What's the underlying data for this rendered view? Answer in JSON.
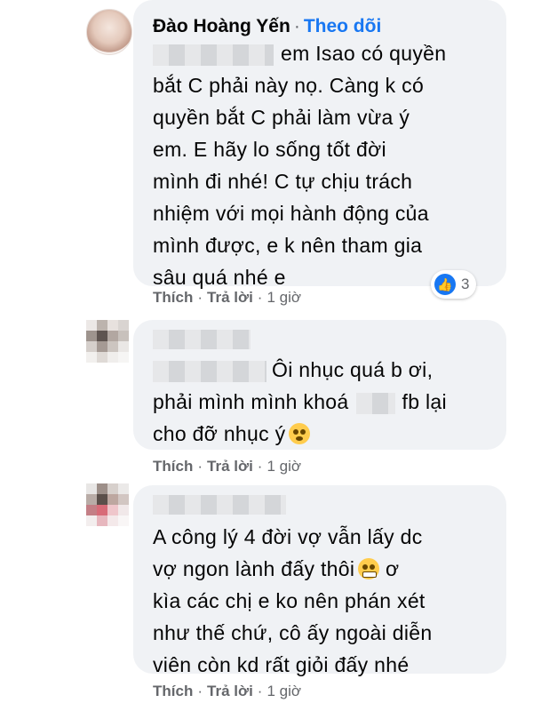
{
  "comments": [
    {
      "name": "Đào Hoàng Yến",
      "follow_label": "Theo dõi",
      "lines": [
        "em Isao có quyền",
        "bắt C phải này nọ. Càng k có",
        "quyền bắt C phải làm vừa ý",
        "em. E hãy lo sống tốt đời",
        "mình đi nhé! C tự chịu trách",
        "nhiệm với mọi hành động của",
        "mình được, e k nên tham gia",
        "sâu quá nhé e"
      ],
      "reaction_count": "3",
      "like_label": "Thích",
      "reply_label": "Trả lời",
      "time": "1 giờ"
    },
    {
      "lines": [
        "Ôi nhục quá b ơi,",
        "phải mình mình khoá",
        "fb lại",
        "cho đỡ nhục ý"
      ],
      "like_label": "Thích",
      "reply_label": "Trả lời",
      "time": "1 giờ"
    },
    {
      "lines": [
        "A công lý 4 đời vợ vẫn lấy dc",
        "vợ ngon lành đấy thôi",
        "ơ",
        "kìa các chị e ko nên phán xét",
        "như thế chứ, cô ấy ngoài diễn",
        "viên còn kd rất giỏi đấy nhé"
      ],
      "like_label": "Thích",
      "reply_label": "Trả lời",
      "time": "1 giờ"
    }
  ],
  "colors": {
    "bubble": "#f0f2f5",
    "link": "#1877f2",
    "meta": "#65676b"
  },
  "icons": [
    "like-icon",
    "flushed-face-emoji",
    "grimacing-face-emoji"
  ]
}
